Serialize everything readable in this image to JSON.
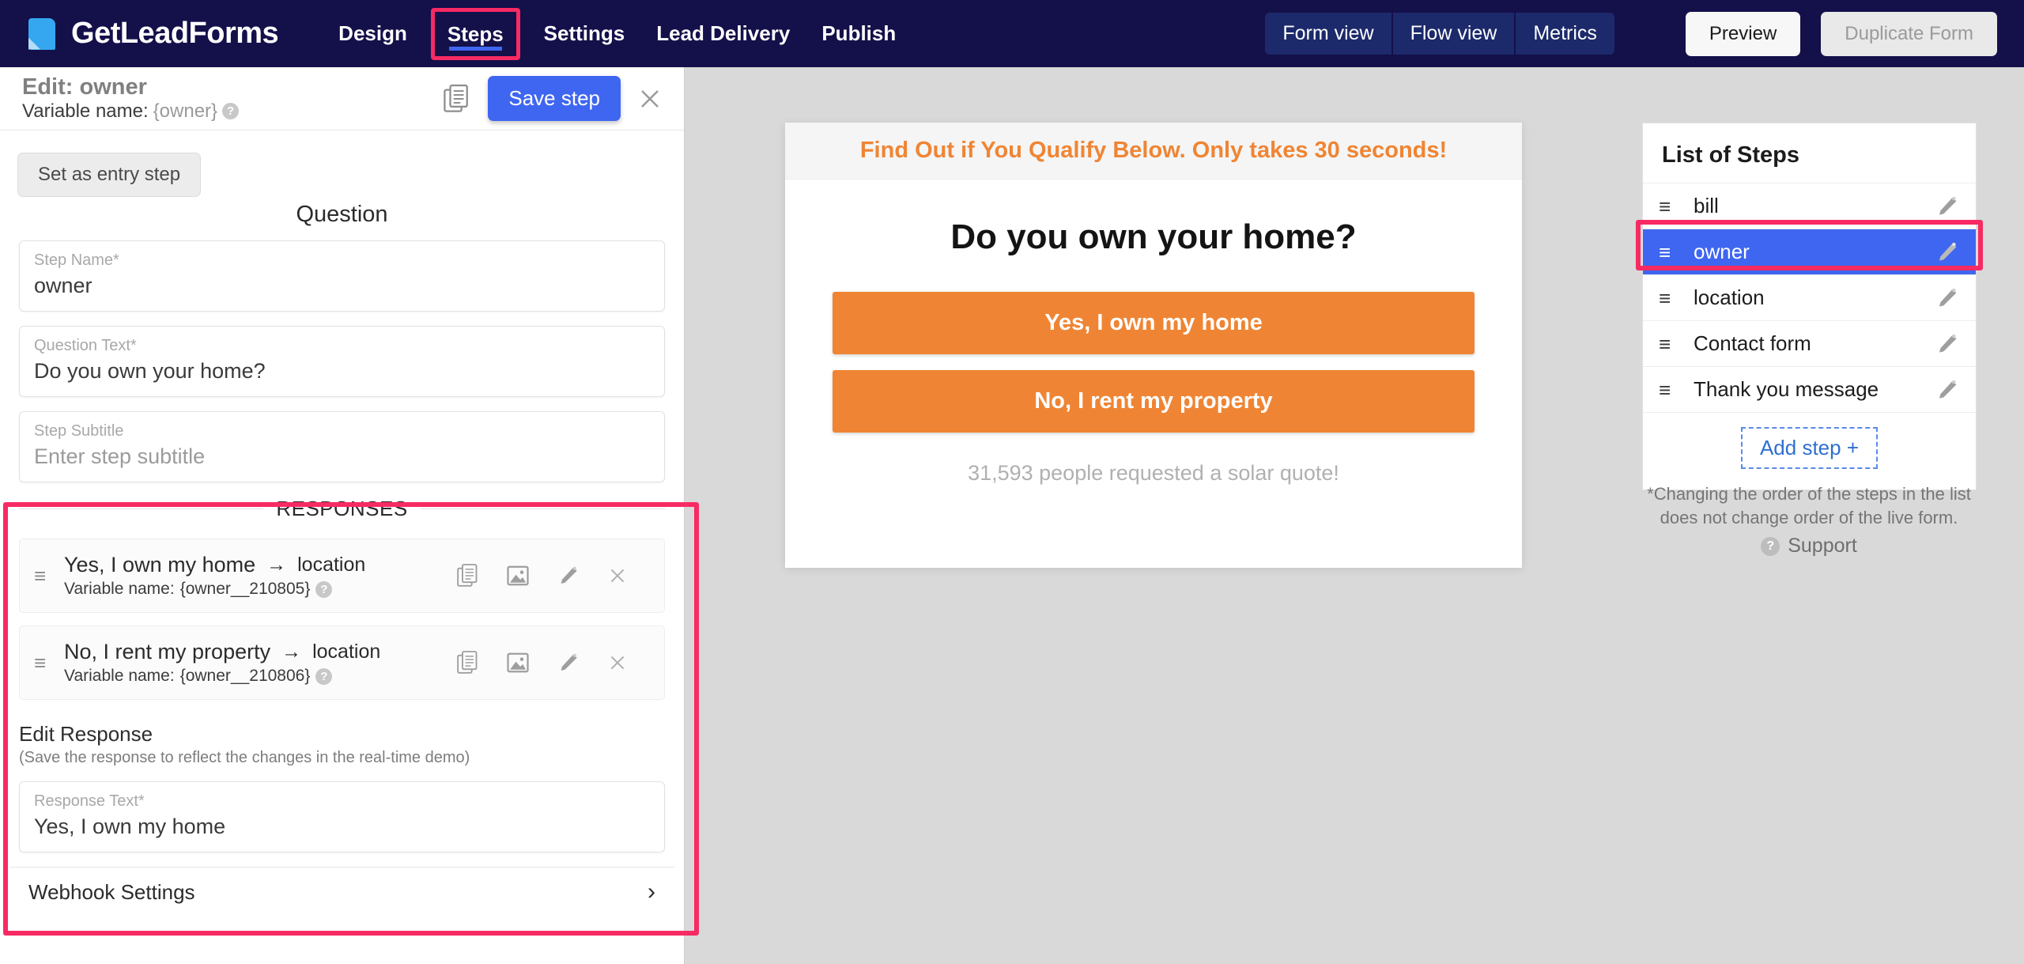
{
  "app": {
    "brand_name": "GetLeadForms",
    "logo_icon": "page-logo-icon"
  },
  "topnav": {
    "menu": [
      {
        "label": "Design",
        "active": false
      },
      {
        "label": "Steps",
        "active": true
      },
      {
        "label": "Settings",
        "active": false
      },
      {
        "label": "Lead Delivery",
        "active": false
      },
      {
        "label": "Publish",
        "active": false
      }
    ],
    "view_segments": [
      {
        "label": "Form view"
      },
      {
        "label": "Flow view"
      },
      {
        "label": "Metrics"
      }
    ],
    "preview_label": "Preview",
    "duplicate_label": "Duplicate Form"
  },
  "left_panel": {
    "header": {
      "title": "Edit: owner",
      "variable_prefix": "Variable name: ",
      "variable_value": "{owner}",
      "help_glyph": "?",
      "duplicate_icon": "duplicate-icon",
      "save_label": "Save step",
      "close_icon": "close-icon"
    },
    "entry_button_label": "Set as entry step",
    "question_section_title": "Question",
    "fields": [
      {
        "label": "Step Name*",
        "value": "owner",
        "is_placeholder": false
      },
      {
        "label": "Question Text*",
        "value": "Do you own your home?",
        "is_placeholder": false
      },
      {
        "label": "Step Subtitle",
        "value": "Enter step subtitle",
        "is_placeholder": true
      }
    ],
    "responses": {
      "section_title": "RESPONSES",
      "rows": [
        {
          "drag_icon": "drag-handle-icon",
          "text": "Yes, I own my home",
          "arrow": "→",
          "destination": "location",
          "variable_prefix": "Variable name: ",
          "variable_value": "{owner__210805}",
          "help_glyph": "?"
        },
        {
          "drag_icon": "drag-handle-icon",
          "text": "No, I rent my property",
          "arrow": "→",
          "destination": "location",
          "variable_prefix": "Variable name: ",
          "variable_value": "{owner__210806}",
          "help_glyph": "?"
        }
      ],
      "row_icons": [
        "duplicate-icon",
        "image-icon",
        "pencil-icon",
        "close-icon"
      ]
    },
    "edit_response": {
      "title": "Edit Response",
      "subtitle": "(Save the response to reflect the changes in the real-time demo)",
      "field_label": "Response Text*",
      "field_value": "Yes, I own my home"
    },
    "webhook": {
      "label": "Webhook Settings",
      "chevron": "›"
    }
  },
  "preview": {
    "banner_text": "Find Out if You Qualify Below. Only takes 30 seconds!",
    "question": "Do you own your home?",
    "answers": [
      {
        "label": "Yes, I own my home"
      },
      {
        "label": "No, I rent my property"
      }
    ],
    "footnote": "31,593 people requested a solar quote!"
  },
  "steps_sidebar": {
    "title": "List of Steps",
    "steps": [
      {
        "label": "bill",
        "selected": false
      },
      {
        "label": "owner",
        "selected": true
      },
      {
        "label": "location",
        "selected": false
      },
      {
        "label": "Contact form",
        "selected": false
      },
      {
        "label": "Thank you message",
        "selected": false
      }
    ],
    "add_step_label": "Add step +",
    "note_line1": "*Changing the order of the steps in the list",
    "note_line2": "does not change order of the live form.",
    "support_label": "Support",
    "support_glyph": "?"
  },
  "colors": {
    "nav_background": "#14104a",
    "accent_blue": "#3f66f0",
    "highlight_pink": "#f72a63",
    "orange": "#ef8534",
    "workspace_background": "#d9d9d9"
  }
}
